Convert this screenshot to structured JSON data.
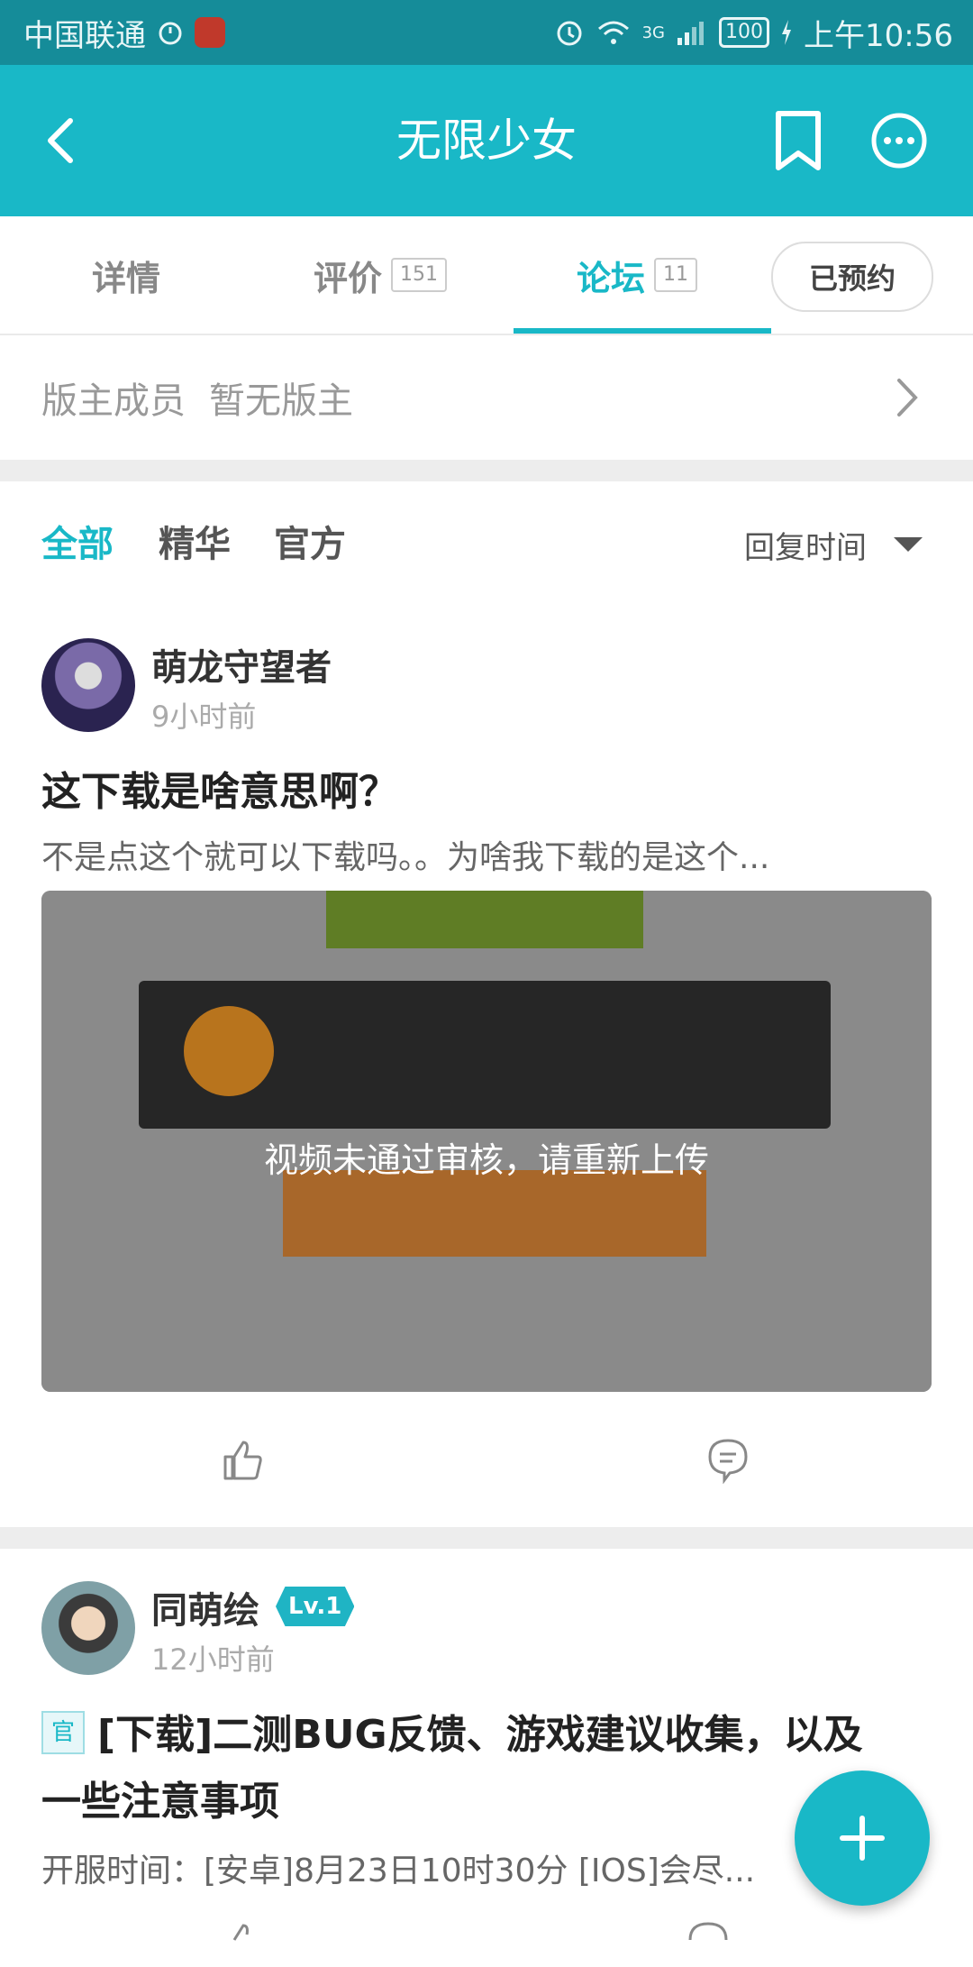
{
  "status_bar": {
    "carrier": "中国联通",
    "network": "3G",
    "battery": "100",
    "time": "上午10:56"
  },
  "header": {
    "title": "无限少女"
  },
  "tabs": [
    {
      "label": "详情",
      "count": ""
    },
    {
      "label": "评价",
      "count": "151"
    },
    {
      "label": "论坛",
      "count": "11"
    }
  ],
  "reserved_button": "已预约",
  "moderator": {
    "label": "版主成员",
    "value": "暂无版主"
  },
  "filters": [
    "全部",
    "精华",
    "官方"
  ],
  "sort_label": "回复时间",
  "posts": [
    {
      "author": "萌龙守望者",
      "time": "9小时前",
      "title": "这下载是啥意思啊？",
      "excerpt": "不是点这个就可以下载吗。。为啥我下载的是这个...",
      "media_notice": "视频未通过审核，请重新上传"
    },
    {
      "author": "同萌绘",
      "level": "Lv.1",
      "time": "12小时前",
      "official_tag": "官",
      "title_line1": "[下载]二测BUG反馈、游戏建议收集，以及",
      "title_line2": "一些注意事项",
      "excerpt": "开服时间：[安卓]8月23日10时30分 [IOS]会尽..."
    }
  ],
  "colors": {
    "accent": "#19b8c7",
    "status_bar": "#158c99"
  },
  "icons": {
    "back": "chevron-left-icon",
    "bookmark": "bookmark-icon",
    "more": "more-icon",
    "like": "thumbs-up-icon",
    "comment": "comment-icon",
    "fab": "plus-icon"
  }
}
